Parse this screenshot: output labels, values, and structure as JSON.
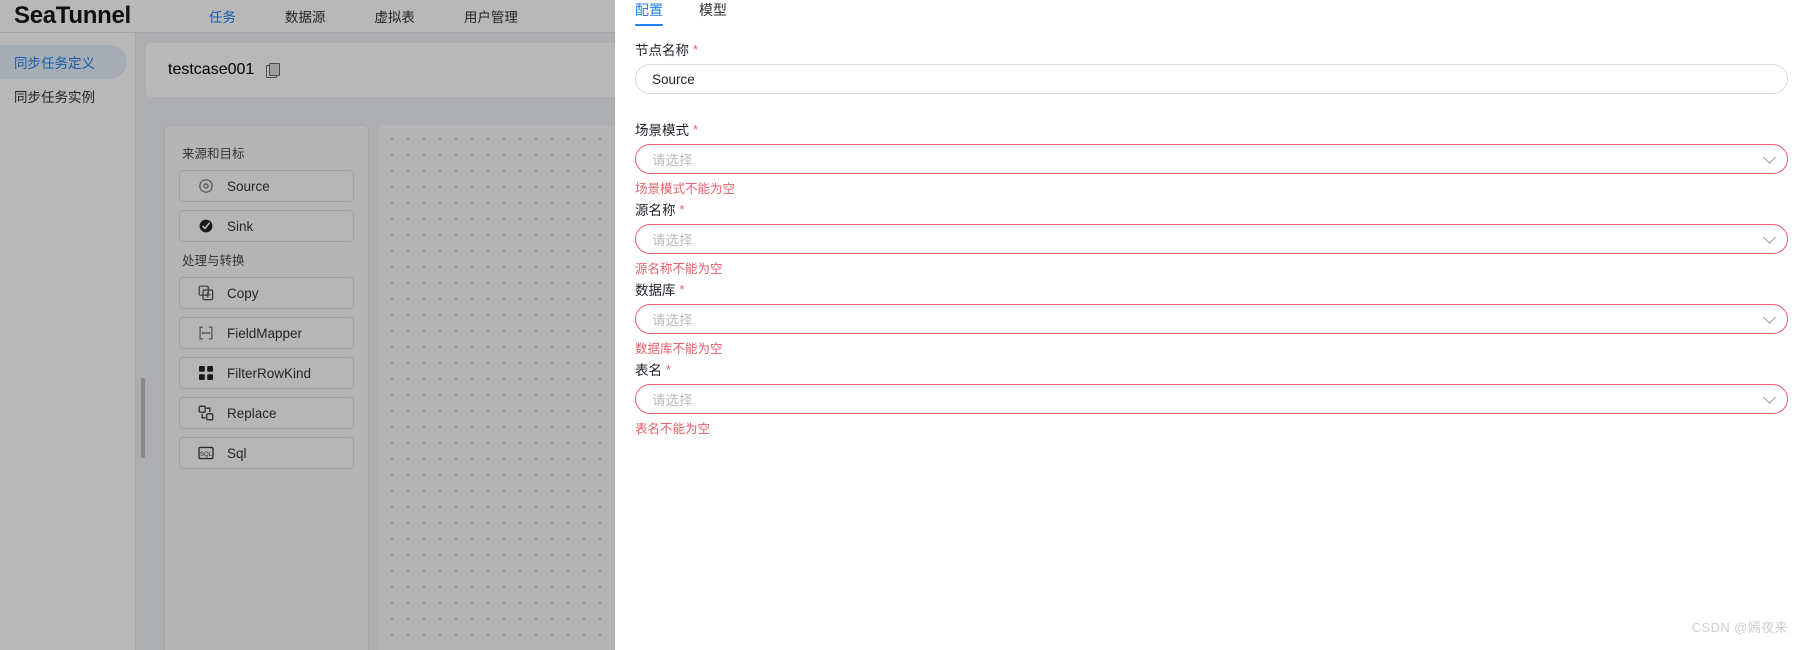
{
  "app": {
    "brand": "SeaTunnel"
  },
  "nav": {
    "items": [
      {
        "label": "任务",
        "active": true
      },
      {
        "label": "数据源",
        "active": false
      },
      {
        "label": "虚拟表",
        "active": false
      },
      {
        "label": "用户管理",
        "active": false
      }
    ]
  },
  "sidebar": {
    "items": [
      {
        "label": "同步任务定义",
        "active": true
      },
      {
        "label": "同步任务实例",
        "active": false
      }
    ]
  },
  "workspace": {
    "breadcrumb_title": "testcase001",
    "copy_icon": "copy-icon"
  },
  "node_panel": {
    "groups": [
      {
        "title": "来源和目标",
        "items": [
          {
            "label": "Source",
            "icon": "target-circle-icon"
          },
          {
            "label": "Sink",
            "icon": "filled-check-circle-icon"
          }
        ]
      },
      {
        "title": "处理与转换",
        "items": [
          {
            "label": "Copy",
            "icon": "copy-squares-icon"
          },
          {
            "label": "FieldMapper",
            "icon": "field-mapper-icon"
          },
          {
            "label": "FilterRowKind",
            "icon": "grid-squares-icon"
          },
          {
            "label": "Replace",
            "icon": "replace-icon"
          },
          {
            "label": "Sql",
            "icon": "sql-box-icon"
          }
        ]
      }
    ]
  },
  "drawer": {
    "tabs": [
      {
        "label": "配置",
        "active": true
      },
      {
        "label": "模型",
        "active": false
      }
    ],
    "fields": [
      {
        "label": "节点名称",
        "required": true,
        "value": "Source",
        "placeholder": "",
        "type": "text",
        "error": "",
        "has_error": false
      },
      {
        "label": "场景模式",
        "required": true,
        "value": "",
        "placeholder": "请选择",
        "type": "select",
        "error": "场景模式不能为空",
        "has_error": true
      },
      {
        "label": "源名称",
        "required": true,
        "value": "",
        "placeholder": "请选择",
        "type": "select",
        "error": "源名称不能为空",
        "has_error": true
      },
      {
        "label": "数据库",
        "required": true,
        "value": "",
        "placeholder": "请选择",
        "type": "select",
        "error": "数据库不能为空",
        "has_error": true
      },
      {
        "label": "表名",
        "required": true,
        "value": "",
        "placeholder": "请选择",
        "type": "select",
        "error": "表名不能为空",
        "has_error": true
      }
    ]
  },
  "watermark": {
    "text": "CSDN @嫣夜来"
  },
  "colors": {
    "accent": "#2080f0",
    "error": "#e8606c",
    "sidebar_active_bg": "#e6f0fb"
  }
}
